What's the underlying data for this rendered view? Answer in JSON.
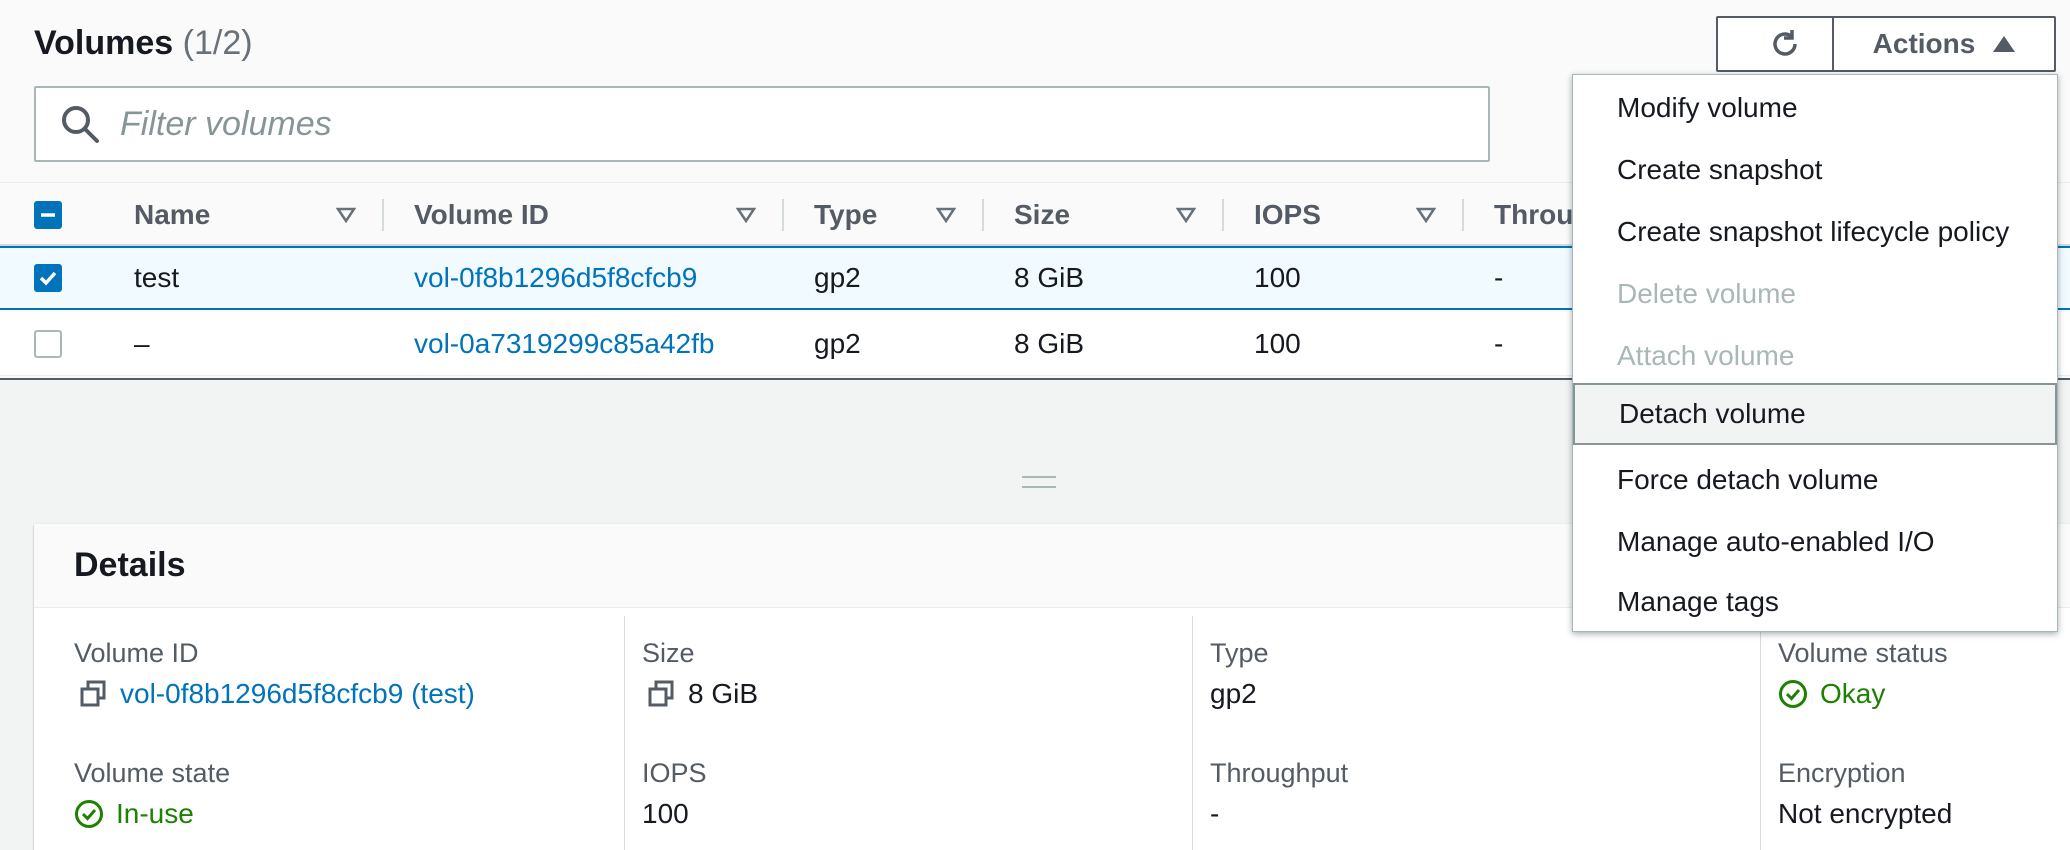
{
  "header": {
    "title": "Volumes",
    "count": "(1/2)",
    "actions_label": "Actions"
  },
  "filter": {
    "placeholder": "Filter volumes"
  },
  "table": {
    "columns": [
      "Name",
      "Volume ID",
      "Type",
      "Size",
      "IOPS",
      "Throu"
    ],
    "rows": [
      {
        "selected": true,
        "name": "test",
        "volume_id": "vol-0f8b1296d5f8cfcb9",
        "type": "gp2",
        "size": "8 GiB",
        "iops": "100",
        "throughput": "-"
      },
      {
        "selected": false,
        "name": "–",
        "volume_id": "vol-0a7319299c85a42fb",
        "type": "gp2",
        "size": "8 GiB",
        "iops": "100",
        "throughput": "-"
      }
    ]
  },
  "details": {
    "title": "Details",
    "volume_id_label": "Volume ID",
    "volume_id_value": "vol-0f8b1296d5f8cfcb9 (test)",
    "size_label": "Size",
    "size_value": "8 GiB",
    "type_label": "Type",
    "type_value": "gp2",
    "volume_status_label": "Volume status",
    "volume_status_value": "Okay",
    "volume_state_label": "Volume state",
    "volume_state_value": "In-use",
    "iops_label": "IOPS",
    "iops_value": "100",
    "throughput_label": "Throughput",
    "throughput_value": "-",
    "encryption_label": "Encryption",
    "encryption_value": "Not encrypted"
  },
  "menu": {
    "items": [
      {
        "label": "Modify volume",
        "disabled": false
      },
      {
        "label": "Create snapshot",
        "disabled": false
      },
      {
        "label": "Create snapshot lifecycle policy",
        "disabled": false
      },
      {
        "label": "Delete volume",
        "disabled": true
      },
      {
        "label": "Attach volume",
        "disabled": true
      },
      {
        "label": "Detach volume",
        "disabled": false,
        "highlighted": true
      },
      {
        "label": "Force detach volume",
        "disabled": false
      },
      {
        "label": "Manage auto-enabled I/O",
        "disabled": false
      },
      {
        "label": "Manage tags",
        "disabled": false
      }
    ]
  },
  "colors": {
    "link": "#0073bb",
    "success": "#1d8102",
    "border": "#545b64",
    "disabled": "#aab7b8"
  },
  "icons": {
    "refresh": "refresh-icon",
    "search": "search-icon",
    "sort": "sort-caret-icon",
    "copy": "copy-icon",
    "status_ok": "check-circle-icon"
  }
}
